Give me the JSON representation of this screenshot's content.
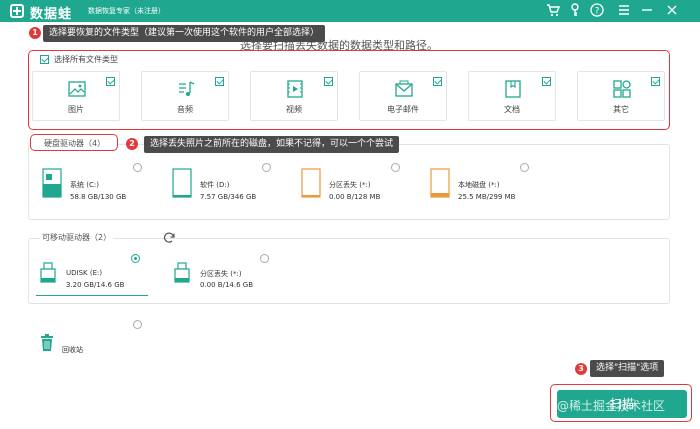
{
  "titlebar": {
    "brand": "数据蛙",
    "app_title": "数据恢复专家（未注册）",
    "icons": [
      "cart-icon",
      "key-icon",
      "help-icon",
      "menu-icon",
      "minimize-icon",
      "close-icon"
    ],
    "bg_color": "#1fa88f"
  },
  "subtitle": "选择要扫描丢失数据的数据类型和路径。",
  "callouts": {
    "c1": {
      "num": "1",
      "text": "选择要恢复的文件类型（建议第一次使用这个软件的用户全部选择）"
    },
    "c2": {
      "num": "2",
      "text": "选择丢失照片之前所在的磁盘，如果不记得，可以一个个尝试"
    },
    "c3": {
      "num": "3",
      "text": "选择\"扫描\"选项"
    }
  },
  "file_types": {
    "select_all_label": "选择所有文件类型",
    "items": [
      {
        "label": "图片",
        "icon": "image-icon",
        "checked": true
      },
      {
        "label": "音频",
        "icon": "music-icon",
        "checked": true
      },
      {
        "label": "视频",
        "icon": "video-icon",
        "checked": true
      },
      {
        "label": "电子邮件",
        "icon": "email-icon",
        "checked": true
      },
      {
        "label": "文档",
        "icon": "document-icon",
        "checked": true
      },
      {
        "label": "其它",
        "icon": "other-icon",
        "checked": true
      }
    ]
  },
  "hard_drives": {
    "title": "硬盘驱动器（4）",
    "items": [
      {
        "name": "系统 (C:)",
        "size": "58.8 GB/130 GB",
        "icon": "system-drive-icon",
        "selected": false
      },
      {
        "name": "软件 (D:)",
        "size": "7.57 GB/346 GB",
        "icon": "drive-icon",
        "selected": false
      },
      {
        "name": "分区丢失 (*:)",
        "size": "0.00  B/128 MB",
        "icon": "lost-partition-icon",
        "selected": false
      },
      {
        "name": "本地磁盘 (*:)",
        "size": "25.5 MB/299 MB",
        "icon": "local-disk-icon",
        "selected": false
      }
    ]
  },
  "removable_drives": {
    "title": "可移动驱动器（2）",
    "items": [
      {
        "name": "UDISK (E:)",
        "size": "3.20 GB/14.6 GB",
        "icon": "usb-icon",
        "selected": true
      },
      {
        "name": "分区丢失 (*:)",
        "size": "0.00  B/14.6 GB",
        "icon": "usb-icon",
        "selected": false
      }
    ]
  },
  "recycle_bin": {
    "label": "回收站",
    "selected": false
  },
  "scan_button": {
    "label": "扫描"
  },
  "watermark": "@稀土掘金技术社区"
}
